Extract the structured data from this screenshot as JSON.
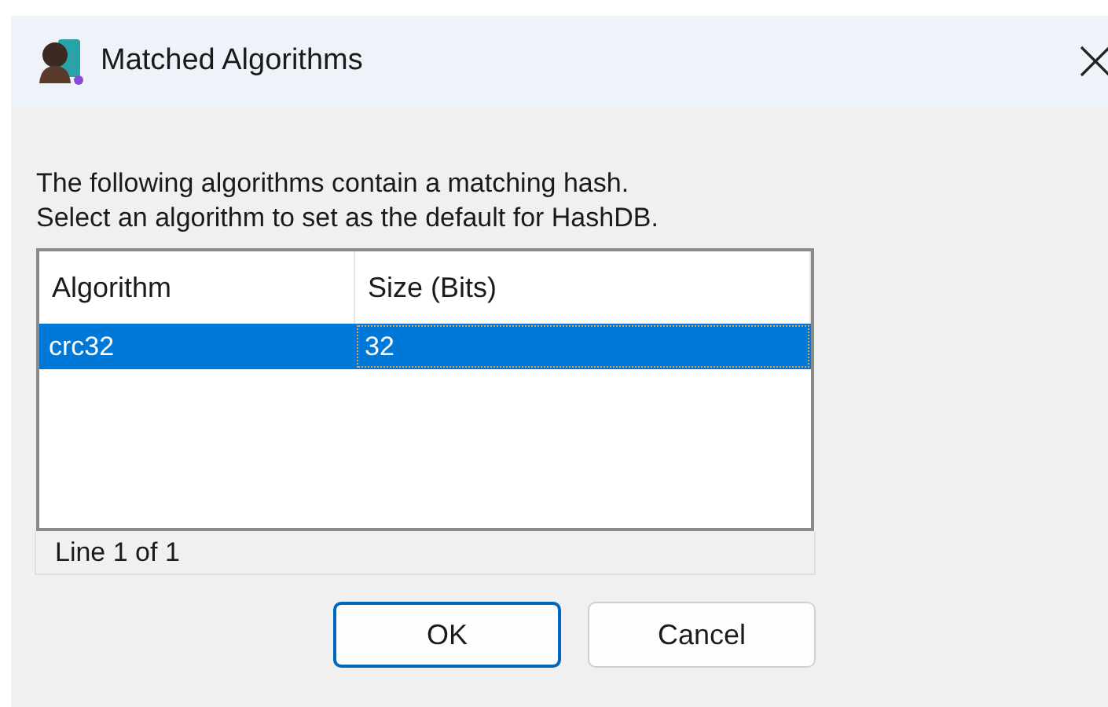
{
  "window": {
    "title": "Matched Algorithms"
  },
  "message": [
    "The following algorithms contain a matching hash.",
    "Select an algorithm to set as the default for HashDB."
  ],
  "table": {
    "columns": [
      "Algorithm",
      "Size (Bits)"
    ],
    "rows": [
      {
        "cells": [
          "crc32",
          "32"
        ],
        "selected": true
      }
    ]
  },
  "status_bar": "Line 1 of 1",
  "buttons": [
    {
      "label": "OK",
      "default": true
    },
    {
      "label": "Cancel",
      "default": false
    }
  ]
}
